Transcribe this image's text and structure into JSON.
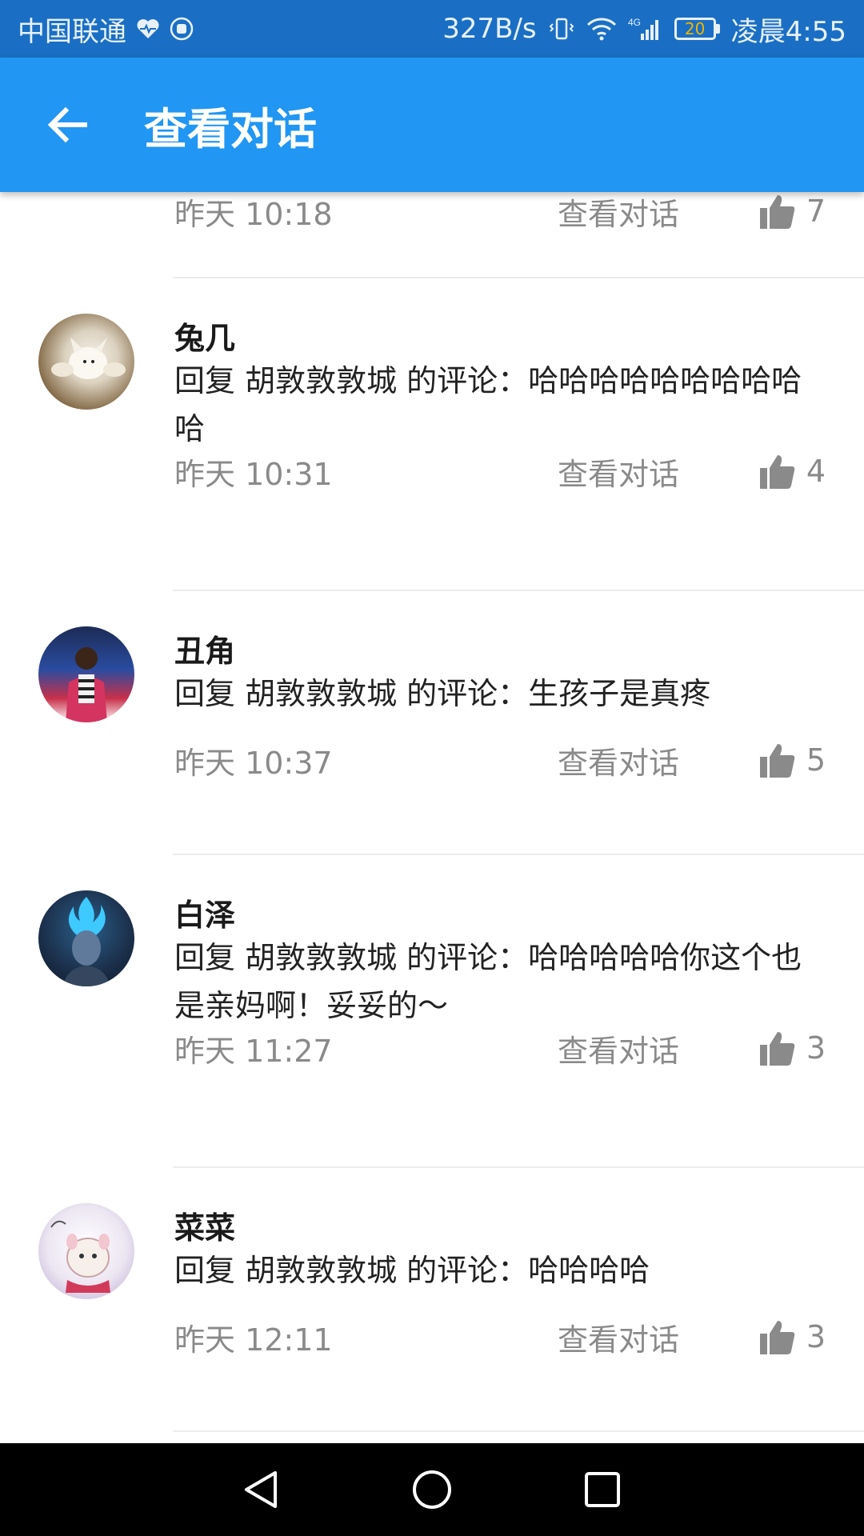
{
  "status_bar": {
    "carrier": "中国联通",
    "speed": "327B/s",
    "network": "4G",
    "battery": "20",
    "time": "凌晨4:55",
    "icons": [
      "heart-pulse-icon",
      "hand-icon",
      "vibrate-icon",
      "wifi-icon",
      "signal-icon",
      "battery-icon"
    ]
  },
  "appbar": {
    "title": "查看对话",
    "back_icon": "arrow-left-icon"
  },
  "colors": {
    "status_bar": "#1a6fc4",
    "app_bar": "#2196f3",
    "meta_text": "#8a8a8a"
  },
  "comments": [
    {
      "time": "昨天 10:18",
      "view_label": "查看对话",
      "likes": "7"
    },
    {
      "name": "兔几",
      "text": "回复 胡敦敦敦城 的评论：哈哈哈哈哈哈哈哈哈哈",
      "time": "昨天 10:31",
      "view_label": "查看对话",
      "likes": "4"
    },
    {
      "name": "丑角",
      "text": "回复 胡敦敦敦城 的评论：生孩子是真疼",
      "time": "昨天 10:37",
      "view_label": "查看对话",
      "likes": "5"
    },
    {
      "name": "白泽",
      "text": "回复 胡敦敦敦城 的评论：哈哈哈哈哈你这个也是亲妈啊！妥妥的～",
      "time": "昨天 11:27",
      "view_label": "查看对话",
      "likes": "3"
    },
    {
      "name": "菜菜",
      "text": "回复 胡敦敦敦城 的评论：哈哈哈哈",
      "time": "昨天 12:11",
      "view_label": "查看对话",
      "likes": "3"
    }
  ],
  "nav": {
    "icons": [
      "back-triangle-icon",
      "home-circle-icon",
      "recents-square-icon"
    ]
  }
}
